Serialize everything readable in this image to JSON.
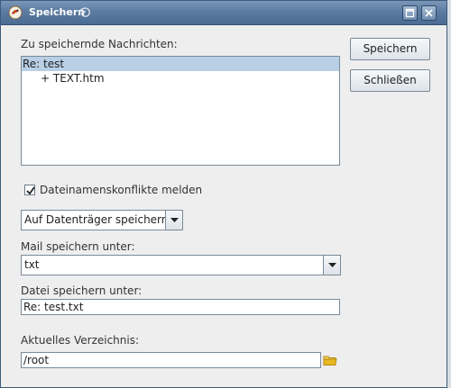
{
  "window": {
    "title": "Speichern"
  },
  "messages": {
    "label": "Zu speichernde Nachrichten:",
    "items": [
      {
        "label": "Re: test"
      },
      {
        "label": "+ TEXT.htm"
      }
    ]
  },
  "buttons": {
    "save": "Speichern",
    "close": "Schließen"
  },
  "checkbox": {
    "label": "Dateinamenskonflikte melden",
    "checked": true
  },
  "destination": {
    "value": "Auf Datenträger speichern"
  },
  "mail_save_as": {
    "label": "Mail speichern unter:",
    "value": "txt"
  },
  "file_save_as": {
    "label": "Datei speichern unter:",
    "value": "Re: test.txt"
  },
  "directory": {
    "label": "Aktuelles Verzeichnis:",
    "value": "/root"
  },
  "colors": {
    "titlebar": "#5b7ba1",
    "selection": "#b8cfe5",
    "folder": "#e8b923"
  },
  "icons": {
    "app": "app-logo-icon",
    "maximize": "maximize-icon",
    "close": "close-icon",
    "dropdown": "chevron-down-icon",
    "folder": "folder-icon",
    "check": "checkmark-icon"
  }
}
